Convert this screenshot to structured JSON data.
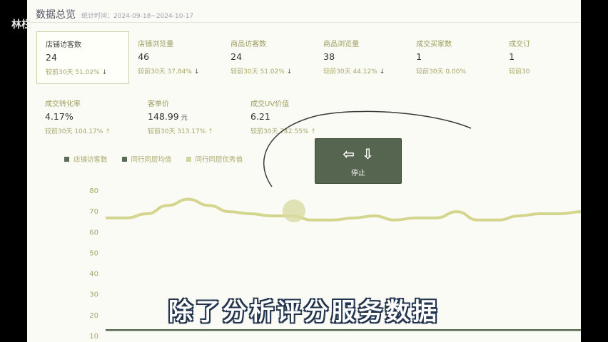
{
  "watermark": "林栏",
  "header": {
    "title": "数据总览",
    "period": "统计时间：2024-09-18~2024-10-17"
  },
  "metrics_rows": [
    [
      {
        "label": "店铺访客数",
        "value": "24",
        "unit": "",
        "compare": "较前30天 51.02%",
        "trend": "down",
        "selected": true
      },
      {
        "label": "店铺浏览量",
        "value": "46",
        "unit": "",
        "compare": "较前30天 37.84%",
        "trend": "down",
        "selected": false
      },
      {
        "label": "商品访客数",
        "value": "24",
        "unit": "",
        "compare": "较前30天 51.02%",
        "trend": "down",
        "selected": false
      },
      {
        "label": "商品浏览量",
        "value": "38",
        "unit": "",
        "compare": "较前30天 44.12%",
        "trend": "down",
        "selected": false
      },
      {
        "label": "成交买家数",
        "value": "1",
        "unit": "",
        "compare": "较前30天 0.00%",
        "trend": "none",
        "selected": false
      },
      {
        "label": "成交订",
        "value": "1",
        "unit": "",
        "compare": "较前30",
        "trend": "none",
        "selected": false
      }
    ],
    [
      {
        "label": "成交转化率",
        "value": "4.17%",
        "unit": "",
        "compare": "较前30天 104.17%",
        "trend": "up",
        "selected": false
      },
      {
        "label": "客单价",
        "value": "148.99",
        "unit": "元",
        "compare": "较前30天 313.17%",
        "trend": "up",
        "selected": false
      },
      {
        "label": "成交UV价值",
        "value": "6.21",
        "unit": "",
        "compare": "较前30天 742.55%",
        "trend": "up",
        "selected": false
      }
    ]
  ],
  "icons": {
    "down": "↓",
    "up": "↑"
  },
  "legend": [
    {
      "label": "店铺访客数",
      "color": "#5b6b56"
    },
    {
      "label": "同行同层均值",
      "color": "#5b6b56"
    },
    {
      "label": "同行同层优秀值",
      "color": "#d4d49e"
    }
  ],
  "chart_data": {
    "type": "line",
    "y_ticks": [
      80,
      70,
      60,
      50,
      40,
      30,
      20,
      10
    ],
    "ylim": [
      10,
      80
    ],
    "series": [
      {
        "name": "同行同层优秀值",
        "color": "#d5d68e",
        "values": [
          67,
          67,
          69,
          73,
          76,
          73,
          70,
          69,
          68,
          68,
          66,
          66,
          67,
          68,
          66,
          67,
          67,
          70,
          66,
          66,
          68,
          69,
          69,
          70
        ]
      },
      {
        "name": "同行同层均值",
        "color": "#56684f",
        "values": [
          13,
          13,
          13,
          13,
          13,
          13,
          13,
          13,
          13,
          13,
          13,
          13,
          13,
          13,
          13,
          13,
          13,
          13,
          13,
          13,
          13,
          13,
          13,
          13
        ]
      }
    ]
  },
  "stop_button": {
    "label": "停止",
    "icon_left": "⇦",
    "icon_down": "⇩"
  },
  "subtitle": "除了分析评分服务数据"
}
